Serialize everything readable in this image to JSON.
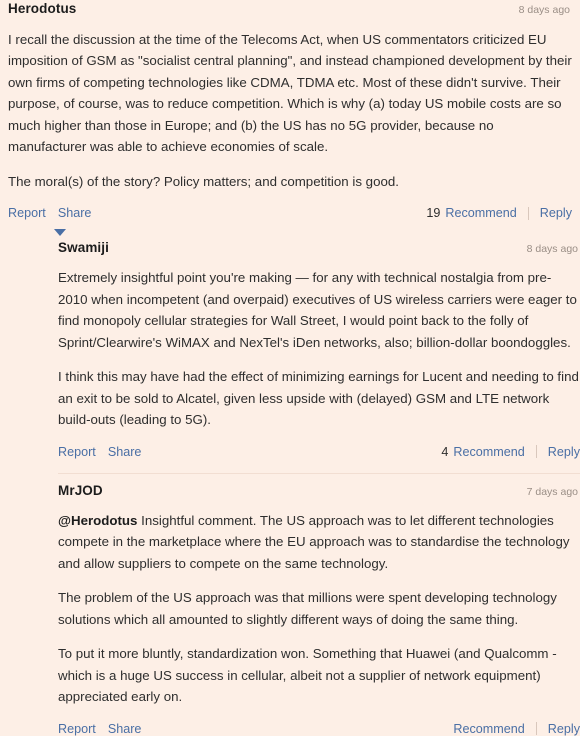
{
  "theme": {
    "background": "#fdefe6",
    "link_color": "#4a6fa5",
    "text_color": "#2e2e2e",
    "timestamp_color": "#9a8e86",
    "divider_color": "#f2ded2"
  },
  "comments": [
    {
      "author": "Herodotus",
      "timestamp": "8 days ago",
      "paragraphs": [
        "I recall the discussion at the time of the Telecoms Act, when US commentators criticized EU imposition of GSM as \"socialist central planning\", and instead championed development by their own firms of competing technologies like CDMA, TDMA etc. Most of these didn't survive. Their purpose, of course, was to reduce competition. Which is why (a) today US mobile costs are so much higher than those in Europe; and (b) the US has no 5G provider, because no manufacturer was able to achieve economies of scale.",
        "The moral(s) of the story? Policy matters; and competition is good."
      ],
      "actions": {
        "report": "Report",
        "share": "Share",
        "recommend_count": "19",
        "recommend": "Recommend",
        "reply": "Reply"
      },
      "collapse_toggle": "collapse-triangle-icon"
    },
    {
      "author": "Swamiji",
      "timestamp": "8 days ago",
      "paragraphs": [
        "Extremely insightful point you're making — for any with technical nostalgia from pre-2010 when incompetent (and overpaid) executives of US wireless carriers were eager to find monopoly cellular strategies for Wall Street, I would point back to the folly of Sprint/Clearwire's WiMAX and NexTel's iDen networks, also; billion-dollar boondoggles.",
        "I think this may have had the effect of minimizing earnings for Lucent and needing to find an exit to be sold to Alcatel, given less upside with (delayed) GSM and LTE network build-outs (leading to 5G)."
      ],
      "actions": {
        "report": "Report",
        "share": "Share",
        "recommend_count": "4",
        "recommend": "Recommend",
        "reply": "Reply"
      }
    },
    {
      "author": "MrJOD",
      "timestamp": "7 days ago",
      "mention": "@Herodotus",
      "paragraphs": [
        " Insightful comment. The US approach was to let different technologies compete in the marketplace where the EU approach was to standardise the technology and allow suppliers to compete on the same technology.",
        "The problem of the US approach was that millions were spent developing technology solutions which all amounted to slightly different ways of doing the same thing.",
        "To put it more bluntly, standardization won. Something that Huawei (and Qualcomm - which is a huge US success in cellular, albeit not a supplier of network equipment) appreciated early on."
      ],
      "actions": {
        "report": "Report",
        "share": "Share",
        "recommend_count": "",
        "recommend": "Recommend",
        "reply": "Reply"
      }
    }
  ]
}
